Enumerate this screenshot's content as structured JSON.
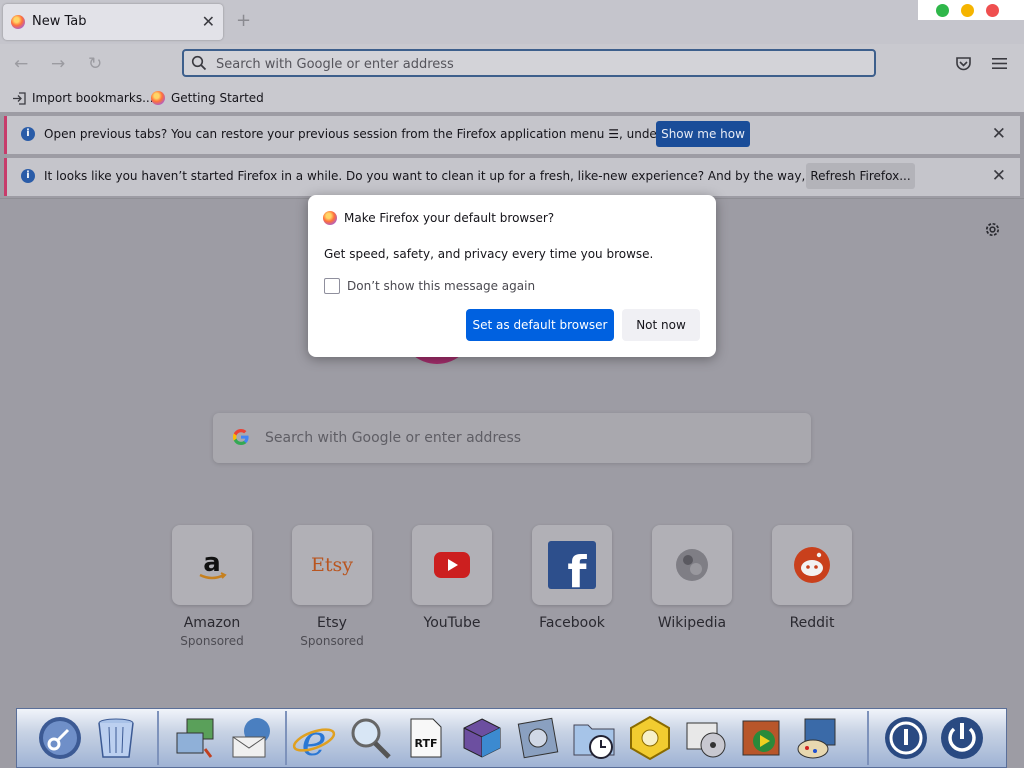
{
  "window": {
    "tab_title": "New Tab",
    "new_tab_symbol": "+",
    "close_symbol": "✕",
    "controls": {
      "green": "#2fb74a",
      "yellow": "#f5b400",
      "red": "#ef4f4f"
    }
  },
  "toolbar": {
    "back": "←",
    "forward": "→",
    "reload": "↻",
    "url_placeholder": "Search with Google or enter address"
  },
  "bookmarks": {
    "import": "Import bookmarks...",
    "getting_started": "Getting Started"
  },
  "notifications": [
    {
      "message": "Open previous tabs? You can restore your previous session from the Firefox application menu ☰, under History.",
      "button": "Show me how"
    },
    {
      "message": "It looks like you haven’t started Firefox in a while. Do you want to clean it up for a fresh, like-new experience? And by the way, welcome back!",
      "button": "Refresh Firefox..."
    }
  ],
  "modal": {
    "title": "Make Firefox your default browser?",
    "body": "Get speed, safety, and privacy every time you browse.",
    "checkbox_label": "Don’t show this message again",
    "primary_button": "Set as default browser",
    "secondary_button": "Not now"
  },
  "newtab": {
    "search_placeholder": "Search with Google or enter address",
    "top_sites": [
      {
        "name": "Amazon",
        "sponsored": "Sponsored",
        "icon": "amazon-icon"
      },
      {
        "name": "Etsy",
        "sponsored": "Sponsored",
        "icon": "etsy-icon",
        "logo_text": "Etsy"
      },
      {
        "name": "YouTube",
        "sponsored": "",
        "icon": "youtube-icon"
      },
      {
        "name": "Facebook",
        "sponsored": "",
        "icon": "facebook-icon"
      },
      {
        "name": "Wikipedia",
        "sponsored": "",
        "icon": "wikipedia-icon"
      },
      {
        "name": "Reddit",
        "sponsored": "",
        "icon": "reddit-icon"
      }
    ]
  },
  "dock": {
    "icons": [
      "key-icon",
      "trash-icon",
      "network-icon",
      "mail-icon",
      "internet-explorer-icon",
      "magnifier-icon",
      "rtf-document-icon",
      "cube-icon",
      "disk-icon",
      "clock-folder-icon",
      "hexagon-settings-icon",
      "media-icon",
      "video-icon",
      "paint-icon",
      "power-icon",
      "shutdown-icon"
    ]
  }
}
